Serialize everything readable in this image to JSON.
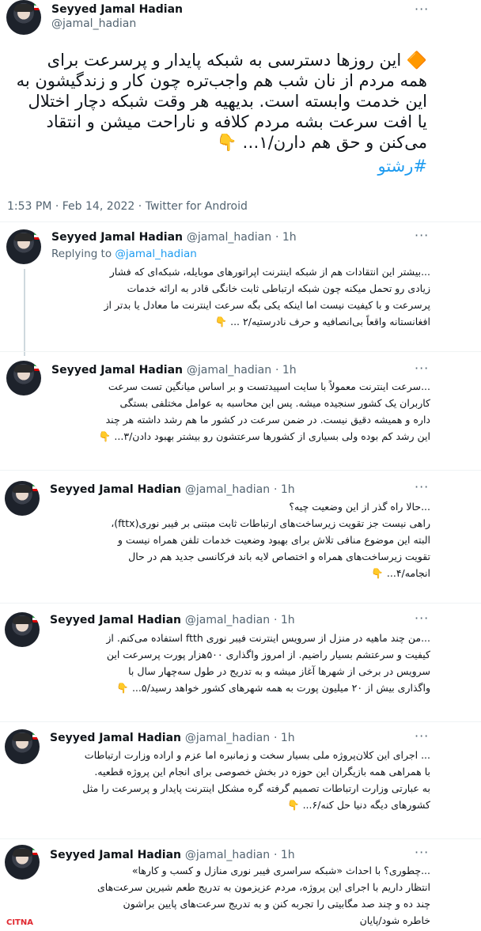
{
  "main_tweet": {
    "name": "Seyyed Jamal Hadian",
    "handle": "@jamal_hadian",
    "text": "🔶 این روزها دسترسی به شبکه پایدار و پرسرعت برای\nهمه مردم از نان شب هم واجب‌تره چون کار و زندگیشون به\nاین خدمت وابسته است. بدیهیه هر وقت شبکه دچار اختلال\nیا افت سرعت بشه مردم کلافه و ناراحت میشن و انتقاد\nمی‌کنن و حق هم دارن/۱… 👇",
    "hashtag": "#رشتو",
    "timestamp": "1:53 PM · Feb 14, 2022 · Twitter for Android"
  },
  "replies": [
    {
      "name": "Seyyed Jamal Hadian",
      "handle": "@jamal_hadian",
      "time": "· 1h",
      "replying_label": "Replying to",
      "replying_to": "@jamal_hadian",
      "text": "...بیشتر این انتقادات هم از شبکه اینترنت اپراتورهای موبایله، شبکه‌ای که فشار\nزیادی رو تحمل میکنه چون شبکه ارتباطی ثابت خانگی قادر به ارائه خدمات\nپرسرعت و با کیفیت نیست اما اینکه یکی بگه سرعت اینترنت ما معادل یا بدتر از\nافغانستانه واقعاً بی‌انصافیه و حرف نادرستیه/۲ ... 👇"
    },
    {
      "name": "Seyyed Jamal Hadian",
      "handle": "@jamal_hadian",
      "time": "· 1h",
      "text": "...سرعت اینترنت معمولاً با سایت اسپیدتست و بر اساس میانگین تست سرعت\nکاربران یک کشور سنجیده میشه. پس این محاسبه به عوامل مختلفی بستگی\nداره و همیشه دقیق نیست. در ضمن سرعت در کشور ما هم رشد  داشته هر چند\nاین رشد کم بوده ولی بسیاری از کشورها سرعتشون رو بیشتر بهبود دادن/۳... 👇"
    },
    {
      "name": "Seyyed Jamal Hadian",
      "handle": "@jamal_hadian",
      "time": "· 1h",
      "text": "...حالا راه گذر از این وضعیت چیه؟\nراهی نیست جز تقویت زیرساخت‌های ارتباطات ثابت مبتنی بر فیبر نوری(fttx)،\nالبته این موضوع منافی تلاش برای بهبود وضعیت خدمات تلفن همراه نیست و\nتقویت زیرساخت‌های همراه و اختصاص لایه باند فرکانسی جدید هم در حال\nانجامه/۴... 👇"
    },
    {
      "name": "Seyyed Jamal Hadian",
      "handle": "@jamal_hadian",
      "time": "· 1h",
      "text": "...من چند ماهیه در منزل از سرویس اینترنت فیبر نوری ftth استفاده می‌کنم. از\nکیفیت و سرعتشم بسیار راضیم. از امروز واگذاری ۵۰۰هزار پورت پرسرعت این\nسرویس در برخی از شهرها آغاز میشه و به تدریج در طول سه‌چهار سال با\nواگذاری بیش از ۲۰ میلیون پورت به همه شهرهای کشور خواهد رسید/۵... 👇"
    },
    {
      "name": "Seyyed Jamal Hadian",
      "handle": "@jamal_hadian",
      "time": "· 1h",
      "text": "... اجرای این کلان‌پروژه ملی بسیار سخت و زمانبره اما عزم و اراده وزارت ارتباطات\nبا همراهی همه بازیگران این حوزه در بخش خصوصی برای انجام این پروژه قطعیه.\nبه عبارتی وزارت ارتباطات تصمیم گرفته گره مشکل اینترنت پایدار و پرسرعت را مثل\nکشورهای دیگه دنیا حل کنه/۶... 👇"
    },
    {
      "name": "Seyyed Jamal Hadian",
      "handle": "@jamal_hadian",
      "time": "· 1h",
      "text": "...چطوری؟ با احداث «شبکه سراسری فیبر نوری منازل و کسب و کارها»\nانتظار داریم با اجرای این پروژه، مردم عزیزمون به تدریج طعم شیرین سرعت‌های\nچند ده و چند صد مگابیتی را تجربه کنن و به تدریج سرعت‌های پایین براشون\nخاطره شود/پایان"
    }
  ],
  "more_icon": "···",
  "watermark": "CITNA"
}
